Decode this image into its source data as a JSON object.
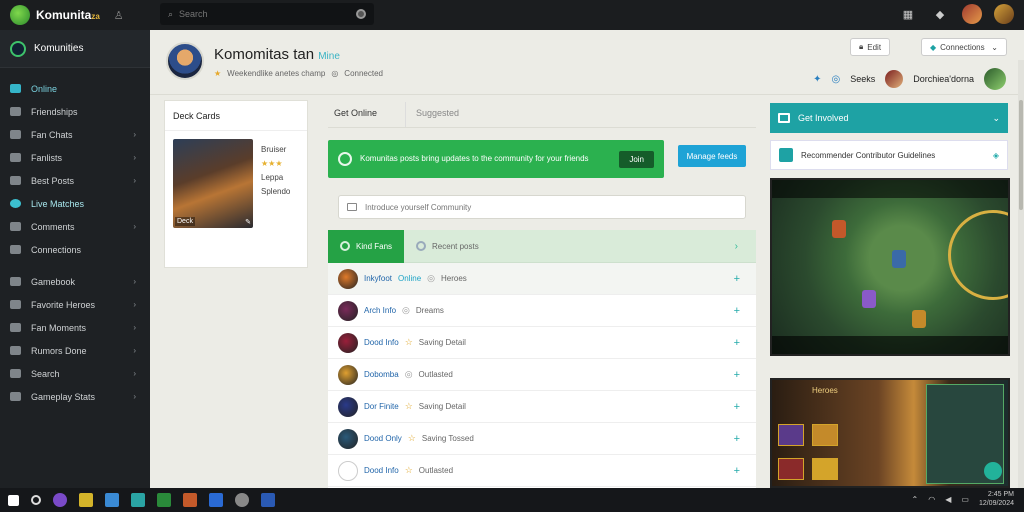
{
  "app": {
    "brand": "Komunita",
    "brand_suffix": "za"
  },
  "search": {
    "placeholder": "Search"
  },
  "sidebar": {
    "header": "Komunities",
    "items": [
      {
        "label": "Online",
        "active": true,
        "chev": false
      },
      {
        "label": "Friendships",
        "chev": false
      },
      {
        "label": "Fan Chats",
        "chev": true
      },
      {
        "label": "Fanlists",
        "chev": true
      },
      {
        "label": "Best Posts",
        "chev": true
      },
      {
        "label": "Live Matches",
        "highlight": true,
        "chev": false
      },
      {
        "label": "Comments",
        "chev": true
      },
      {
        "label": "Connections",
        "chev": false
      },
      {
        "label": "Gamebook",
        "chev": true
      },
      {
        "label": "Favorite Heroes",
        "chev": true
      },
      {
        "label": "Fan Moments",
        "chev": true
      },
      {
        "label": "Rumors Done",
        "chev": true
      },
      {
        "label": "Search",
        "chev": true
      },
      {
        "label": "Gameplay Stats",
        "chev": true
      }
    ]
  },
  "profile": {
    "name": "Komomitas tan",
    "tag": "Mine",
    "subtitle": "Weekendlike anetes champ",
    "rank": "Connected"
  },
  "header": {
    "btn1": "Edit",
    "btn2": "Connections",
    "fav": "Seeks",
    "user": "Dorchiea'dorna"
  },
  "card": {
    "title": "Deck Cards",
    "img_label": "Deck",
    "img_edit": "Edit",
    "meta_name": "Bruiser",
    "meta_stars": "★★★",
    "meta_line1": "Leppa",
    "meta_line2": "Splendo"
  },
  "tabs": {
    "active": "Get Online",
    "inactive": "Suggested"
  },
  "banner": {
    "text": "Komunitas posts bring updates to the community for your friends",
    "action": "Join",
    "secondary": "Manage feeds"
  },
  "input": {
    "placeholder": "Introduce yourself Community"
  },
  "list": {
    "tab_active": "Kind Fans",
    "tab_other": "Recent posts",
    "rows": [
      {
        "name": "Inkyfoot",
        "name2": "Online",
        "status": "Heroes",
        "icon": "gray",
        "avatar": "#e07a2a"
      },
      {
        "name": "Arch Info",
        "status": "Dreams",
        "icon": "gray",
        "avatar": "#7a2a5a"
      },
      {
        "name": "Dood Info",
        "status": "Saving Detail",
        "icon": "yellow",
        "avatar": "#9a1f3a"
      },
      {
        "name": "Dobomba",
        "status": "Outlasted",
        "icon": "gray",
        "avatar": "#e0a030"
      },
      {
        "name": "Dor Finite",
        "status": "Saving Detail",
        "icon": "yellow",
        "avatar": "#2a3a8a"
      },
      {
        "name": "Dood Only",
        "status": "Saving Tossed",
        "icon": "yellow",
        "avatar": "#2a5a7a"
      },
      {
        "name": "Dood Info",
        "status": "Outlasted",
        "icon": "yellow",
        "avatar": "#eeeeee"
      }
    ]
  },
  "right": {
    "head": "Get Involved",
    "sub": "Recommender Contributor Guidelines"
  },
  "game2": {
    "title": "Heroes"
  },
  "taskbar": {
    "time": "2:45 PM",
    "date": "12/09/2024"
  },
  "colors": {
    "accent_green": "#2bb14f",
    "accent_teal": "#1ea2a4",
    "accent_blue": "#1ea3d6",
    "sidebar_bg": "#1e2124"
  }
}
